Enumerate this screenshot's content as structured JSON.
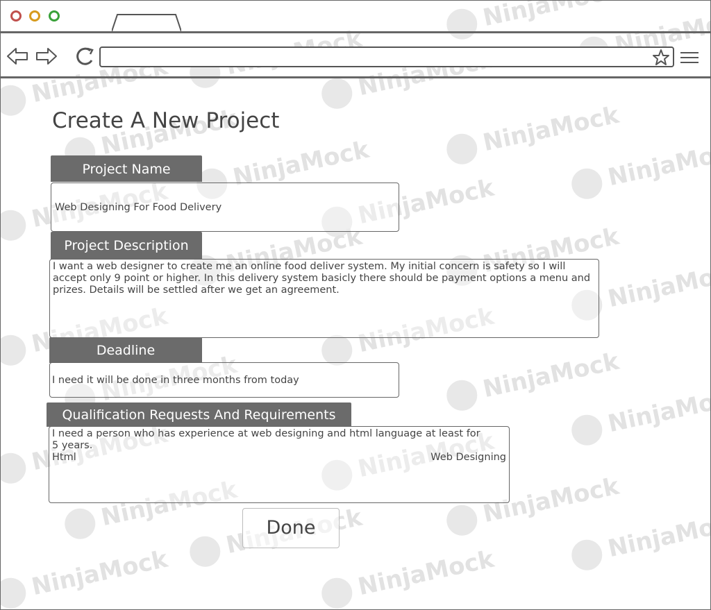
{
  "browser": {
    "tab_label": "",
    "address_value": "",
    "icons": [
      "back-icon",
      "forward-icon",
      "reload-icon",
      "star-icon",
      "menu-icon"
    ]
  },
  "watermark": "NinjaMock",
  "form": {
    "title": "Create A New Project",
    "project_name": {
      "label": "Project Name",
      "value": "Web Designing For Food Delivery"
    },
    "project_description": {
      "label": "Project Description",
      "value": "I want a web designer to create me an online food deliver system. My initial concern is safety so I will accept only 9 point or higher. In this delivery system basicly there should be payment options a menu and prizes. Details will be settled after we get an agreement."
    },
    "deadline": {
      "label": "Deadline",
      "value": "I need it will be done in three months from today"
    },
    "qualifications": {
      "label": "Qualification Requests And Requirements",
      "value": "I need a person who has experience at web designing and html language at least for 5 years.",
      "tag_left": "Html",
      "tag_right": "Web Designing"
    },
    "done_label": "Done"
  }
}
